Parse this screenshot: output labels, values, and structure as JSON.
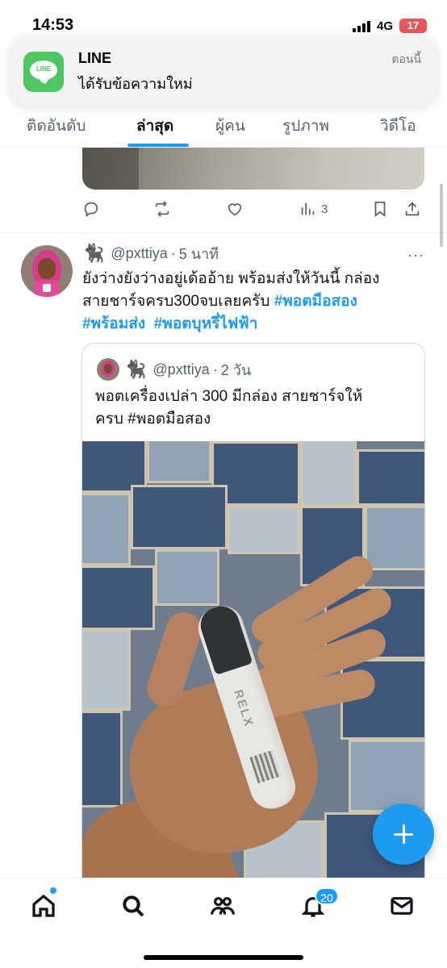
{
  "status_bar": {
    "time": "14:53",
    "network": "4G",
    "battery": "17"
  },
  "notification": {
    "app": "LINE",
    "message": "ได้รับข้อความใหม่",
    "time": "ตอนนี้",
    "icon": "line-app-icon",
    "icon_text": "LINE"
  },
  "tabs": [
    {
      "label": "ติดอันดับ",
      "active": false
    },
    {
      "label": "ล่าสุด",
      "active": true
    },
    {
      "label": "ผู้คน",
      "active": false
    },
    {
      "label": "รูปภาพ",
      "active": false
    },
    {
      "label": "วิดีโอ",
      "active": false
    }
  ],
  "previous_tweet": {
    "views": "3"
  },
  "tweet": {
    "emoji": "🐈‍⬛",
    "handle": "@pxttiya",
    "separator": "·",
    "time": "5 นาที",
    "more": "···",
    "text_line1": "ยังว่างยังว่างอยู่เด้ออ้าย พร้อมส่งให้วันนี้ กล่อง",
    "text_line2_plain": "สายชาร์จครบ300จบเลยครับ ",
    "hashtag1": "#พอตมือสอง",
    "hashtag2": "#พร้อมส่ง",
    "hashtag3": "#พอตบุหรี่ไฟฟ้า"
  },
  "quote": {
    "emoji": "🐈‍⬛",
    "handle": "@pxttiya",
    "separator": "·",
    "time": "2 วัน",
    "text_line1": "พอตเครื่องเปล่า 300 มีกล่อง สายชาร์จให้",
    "text_line2_plain": "ครบ ",
    "hashtag": "#พอตมือสอง",
    "product_label": "RELX"
  },
  "bottom_nav": {
    "items": [
      "home-icon",
      "search-icon",
      "communities-icon",
      "notifications-icon",
      "messages-icon"
    ],
    "notifications_badge": "20"
  },
  "colors": {
    "accent": "#1d9bf0",
    "line_green": "#4cc764",
    "battery": "#e8555a"
  }
}
